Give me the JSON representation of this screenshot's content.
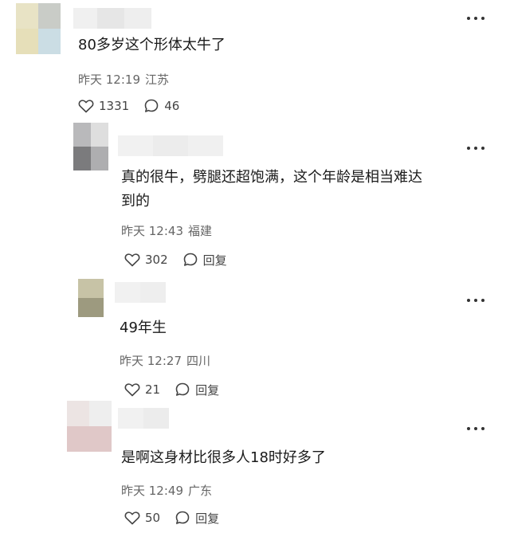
{
  "comments": [
    {
      "text": "80多岁这个形体太牛了",
      "time": "昨天 12:19",
      "location": "江苏",
      "likes": "1331",
      "comments_count": "46"
    },
    {
      "text_line1": "真的很牛，劈腿还超饱满，这个年龄是相当难达",
      "text_line2": "到的",
      "time": "昨天 12:43",
      "location": "福建",
      "likes": "302",
      "reply_label": "回复"
    },
    {
      "text": "49年生",
      "time": "昨天 12:27",
      "location": "四川",
      "likes": "21",
      "reply_label": "回复"
    },
    {
      "text": "是啊这身材比很多人18时好多了",
      "time": "昨天 12:49",
      "location": "广东",
      "likes": "50",
      "reply_label": "回复"
    }
  ],
  "avatar_colors": [
    [
      "#e8e3c5",
      "#c9ccc7",
      "#e6dfb9",
      "#cbdde4"
    ],
    [
      "#b9b9bb",
      "#dedede",
      "#7b7b7d",
      "#aeaeb0"
    ],
    [
      "#c7c3a6",
      "#c7c3a6",
      "#9d9a7f",
      "#9d9a7f"
    ],
    [
      "#ece4e3",
      "#eeeeee",
      "#e0c8c8",
      "#e0c8c8"
    ]
  ],
  "icons": {
    "like": "heart-outline-icon",
    "comment": "speech-bubble-icon",
    "more": "more-dots-icon"
  }
}
